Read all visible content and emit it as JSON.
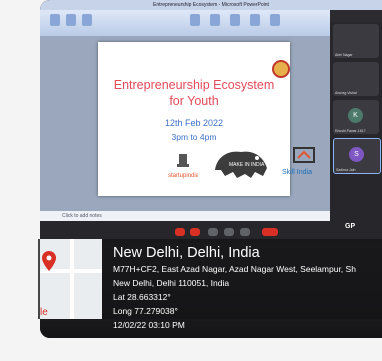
{
  "window": {
    "title": "Entrepreneurship Ecosystem - Microsoft PowerPoint"
  },
  "slide": {
    "title_line1": "Entrepreneurship Ecosystem",
    "title_line2": "for Youth",
    "date": "12th Feb 2022",
    "time": "3pm to 4pm",
    "logo_startup": "startupindia",
    "logo_make_in_india": "MAKE IN INDIA",
    "logo_skill_india": "Skill India"
  },
  "notes_placeholder": "Click to add notes",
  "participants": [
    {
      "name": "Abhi Nagar",
      "initial": "",
      "color": "#555a66"
    },
    {
      "name": "Anurag Vishal",
      "initial": "",
      "color": "#6b5b4b"
    },
    {
      "name": "Khushi Pawar-1617",
      "initial": "K",
      "color": "#4b7a6b"
    },
    {
      "name": "Sadhna Jain",
      "initial": "S",
      "color": "#7e57c2"
    }
  ],
  "self_label": "GP",
  "geotag": {
    "title": "New Delhi, Delhi, India",
    "address_line1": "M77H+CF2, East Azad Nagar, Azad Nagar West, Seelampur, Sh",
    "address_line2": "New Delhi, Delhi 110051, India",
    "lat": "Lat 28.663312°",
    "long": "Long 77.279038°",
    "datetime": "12/02/22 03:10 PM",
    "map_label": "le"
  },
  "colors": {
    "slide_title": "#e44a5a",
    "slide_date": "#3d6fc7",
    "overlay_bg": "#141416",
    "pin": "#d93025"
  }
}
